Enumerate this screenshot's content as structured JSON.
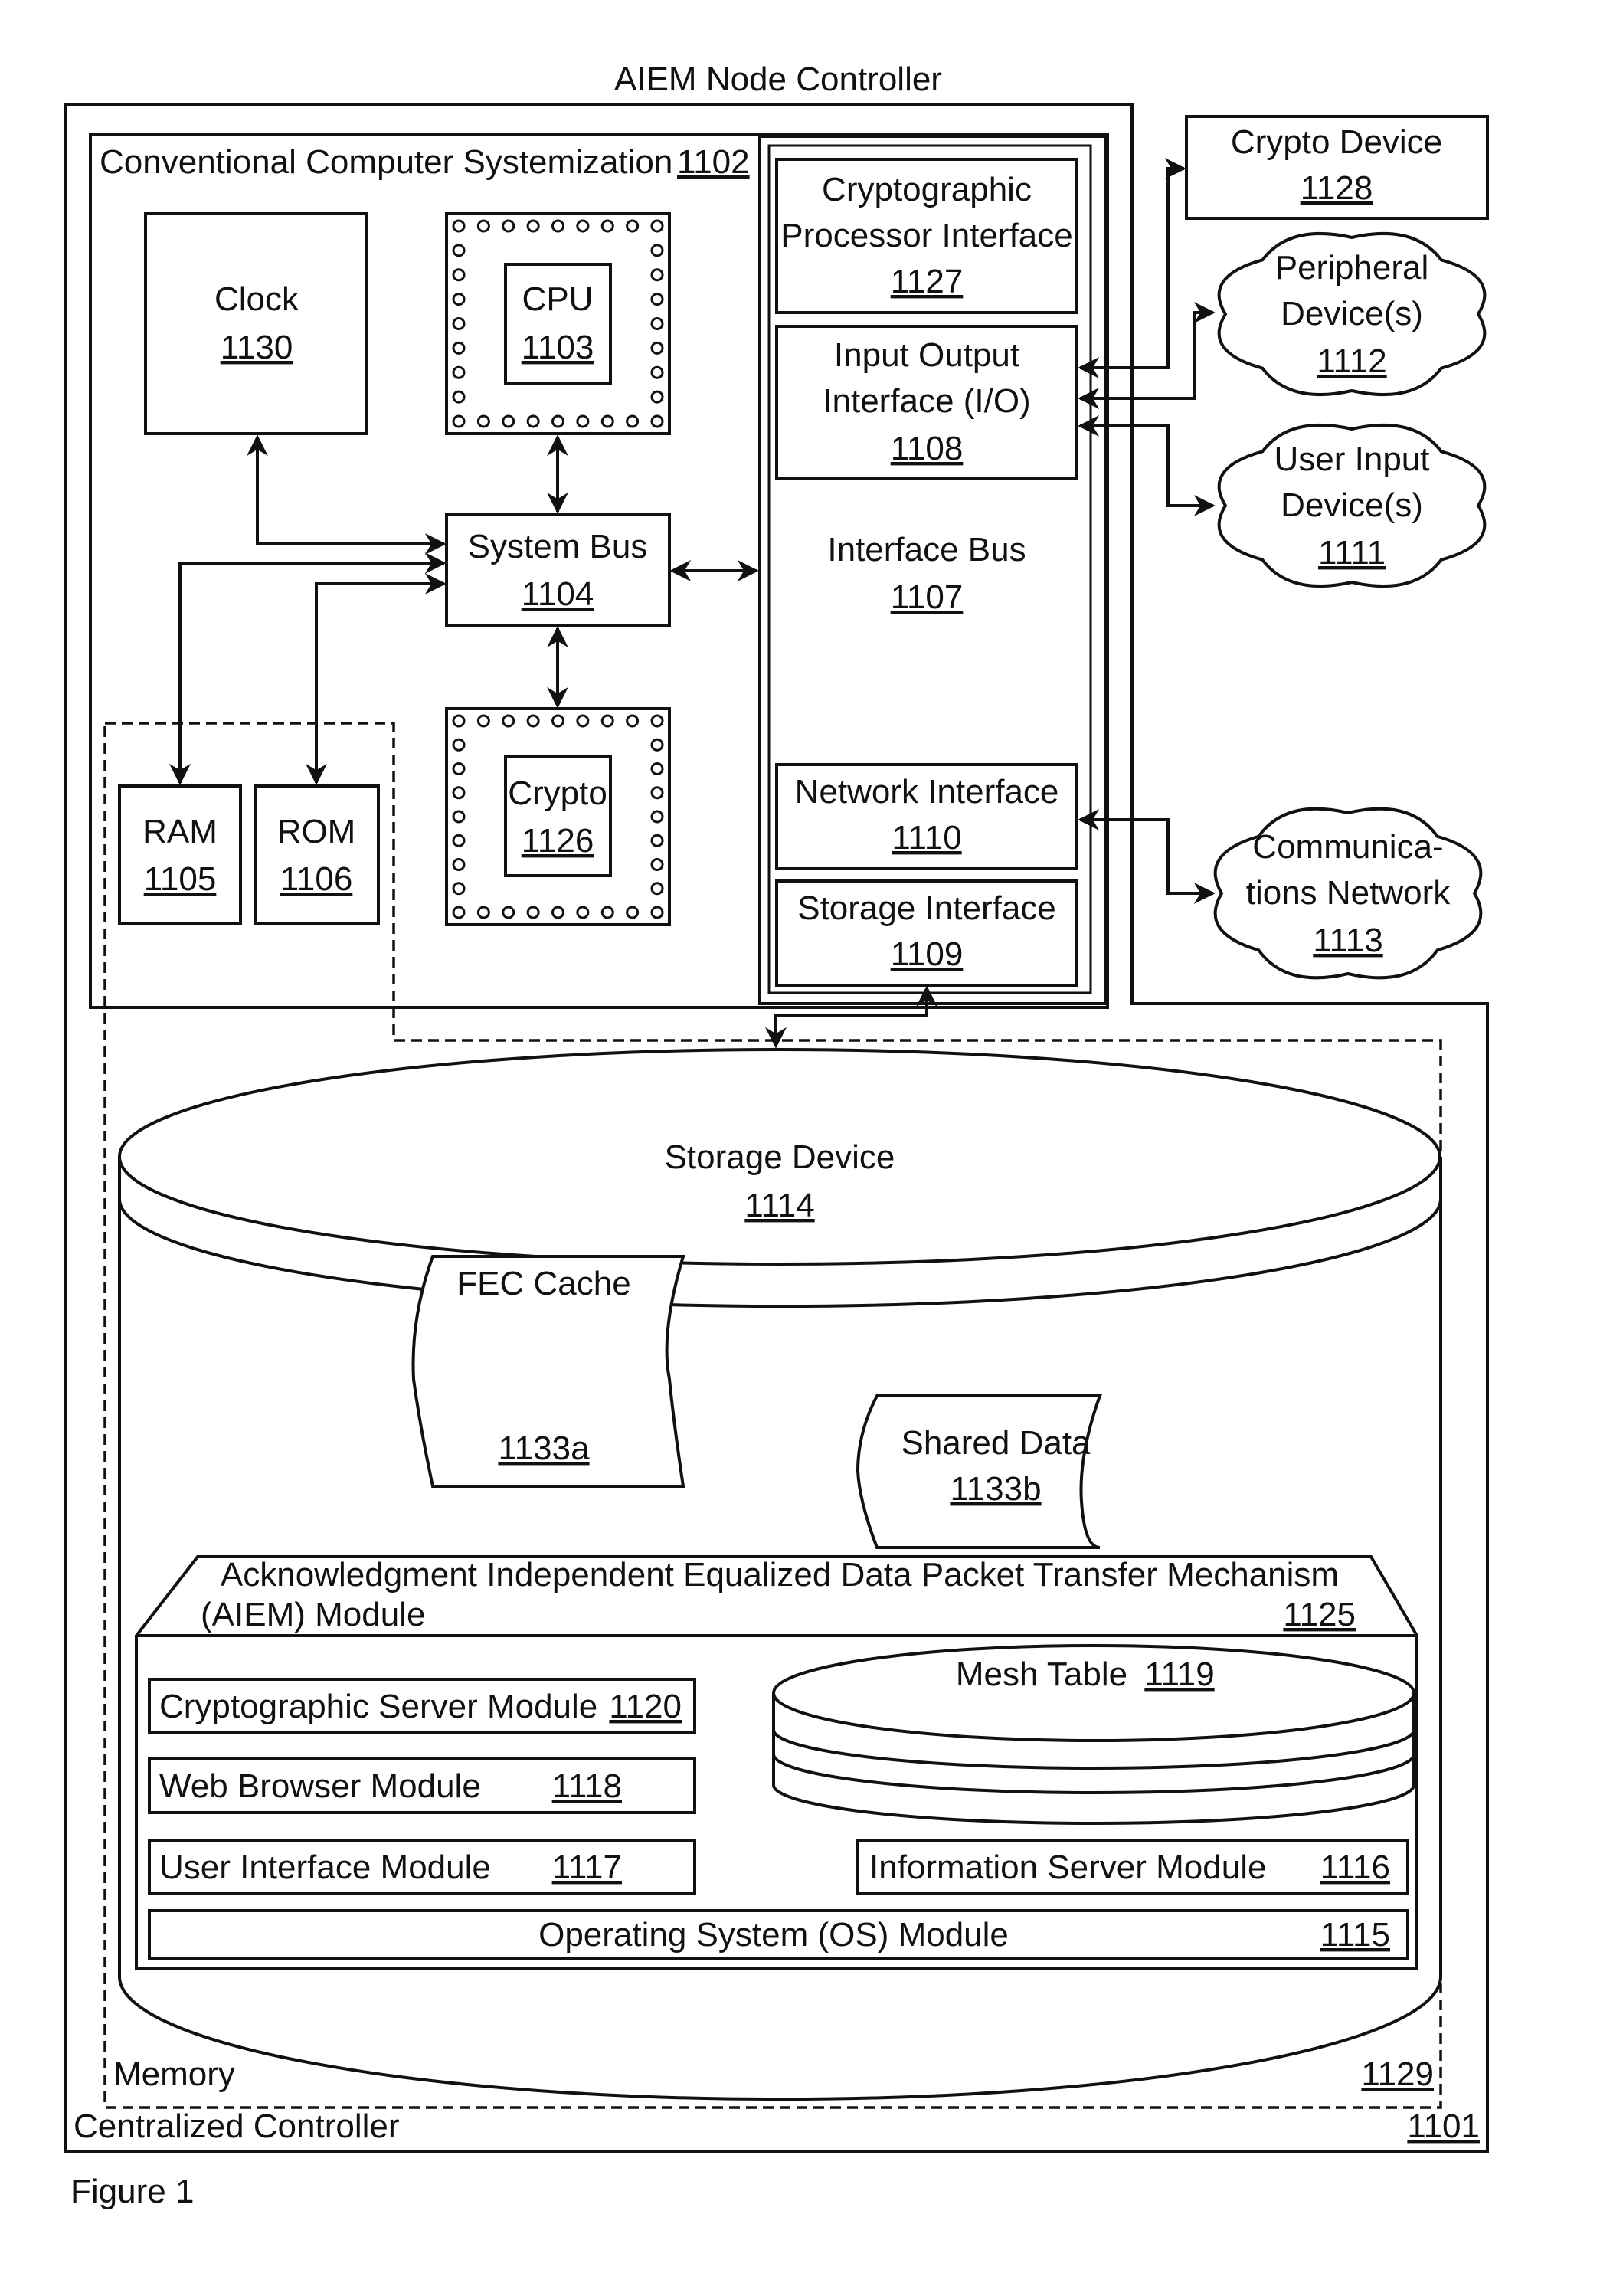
{
  "figure": {
    "title": "AIEM Node Controller",
    "caption": "Figure 1"
  },
  "centralized_controller": {
    "label": "Centralized Controller",
    "ref": "1101"
  },
  "systemization": {
    "label": "Conventional Computer Systemization",
    "ref": "1102"
  },
  "clock": {
    "label": "Clock",
    "ref": "1130"
  },
  "cpu": {
    "label": "CPU",
    "ref": "1103"
  },
  "system_bus": {
    "label": "System Bus",
    "ref": "1104"
  },
  "crypto_chip": {
    "label": "Crypto",
    "ref": "1126"
  },
  "ram": {
    "label": "RAM",
    "ref": "1105"
  },
  "rom": {
    "label": "ROM",
    "ref": "1106"
  },
  "interface_bus": {
    "label": "Interface Bus",
    "ref": "1107"
  },
  "crypto_processor_interface": {
    "line1": "Cryptographic",
    "line2": "Processor Interface",
    "ref": "1127"
  },
  "io_interface": {
    "line1": "Input Output",
    "line2": "Interface (I/O)",
    "ref": "1108"
  },
  "network_interface": {
    "label": "Network Interface",
    "ref": "1110"
  },
  "storage_interface": {
    "label": "Storage Interface",
    "ref": "1109"
  },
  "crypto_device": {
    "label": "Crypto Device",
    "ref": "1128"
  },
  "peripheral_devices": {
    "line1": "Peripheral",
    "line2": "Device(s)",
    "ref": "1112"
  },
  "user_input_devices": {
    "line1": "User Input",
    "line2": "Device(s)",
    "ref": "1111"
  },
  "communications_network": {
    "line1": "Communica-",
    "line2": "tions Network",
    "ref": "1113"
  },
  "memory": {
    "label": "Memory",
    "ref": "1129"
  },
  "storage_device": {
    "label": "Storage Device",
    "ref": "1114"
  },
  "fec_cache": {
    "label": "FEC Cache",
    "ref": "1133a"
  },
  "shared_data": {
    "label": "Shared Data",
    "ref": "1133b"
  },
  "aiem_module": {
    "line1": "Acknowledgment Independent Equalized Data Packet Transfer Mechanism",
    "line2": "(AIEM) Module",
    "ref": "1125"
  },
  "modules": {
    "crypto_server": {
      "label": "Cryptographic Server Module",
      "ref": "1120"
    },
    "web_browser": {
      "label": "Web Browser Module",
      "ref": "1118"
    },
    "user_interface": {
      "label": "User Interface Module",
      "ref": "1117"
    },
    "mesh_table": {
      "label": "Mesh Table",
      "ref": "1119"
    },
    "information_server": {
      "label": "Information Server Module",
      "ref": "1116"
    },
    "operating_system": {
      "label": "Operating System (OS) Module",
      "ref": "1115"
    }
  }
}
